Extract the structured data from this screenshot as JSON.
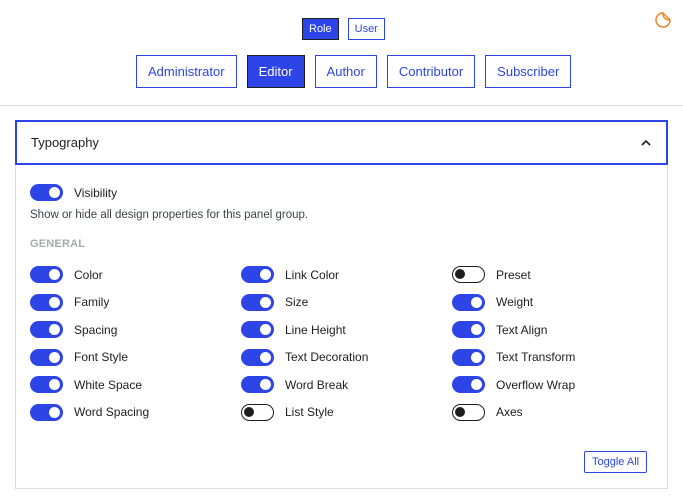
{
  "mode_switch": {
    "options": [
      {
        "label": "Role",
        "active": true
      },
      {
        "label": "User",
        "active": false
      }
    ]
  },
  "top_right_icon": "sticker-icon",
  "role_tabs": [
    {
      "label": "Administrator",
      "active": false
    },
    {
      "label": "Editor",
      "active": true
    },
    {
      "label": "Author",
      "active": false
    },
    {
      "label": "Contributor",
      "active": false
    },
    {
      "label": "Subscriber",
      "active": false
    }
  ],
  "panel": {
    "title": "Typography",
    "expanded": true,
    "visibility": {
      "label": "Visibility",
      "on": true
    },
    "help_text": "Show or hide all design properties for this panel group.",
    "section_label": "GENERAL",
    "columns": [
      [
        {
          "label": "Color",
          "on": true
        },
        {
          "label": "Family",
          "on": true
        },
        {
          "label": "Spacing",
          "on": true
        },
        {
          "label": "Font Style",
          "on": true
        },
        {
          "label": "White Space",
          "on": true
        },
        {
          "label": "Word Spacing",
          "on": true
        }
      ],
      [
        {
          "label": "Link Color",
          "on": true
        },
        {
          "label": "Size",
          "on": true
        },
        {
          "label": "Line Height",
          "on": true
        },
        {
          "label": "Text Decoration",
          "on": true
        },
        {
          "label": "Word Break",
          "on": true
        },
        {
          "label": "List Style",
          "on": false
        }
      ],
      [
        {
          "label": "Preset",
          "on": false
        },
        {
          "label": "Weight",
          "on": true
        },
        {
          "label": "Text Align",
          "on": true
        },
        {
          "label": "Text Transform",
          "on": true
        },
        {
          "label": "Overflow Wrap",
          "on": true
        },
        {
          "label": "Axes",
          "on": false
        }
      ]
    ],
    "toggle_all_label": "Toggle All"
  },
  "colors": {
    "accent": "#2d45e6",
    "sticker_icon": "#f0821e",
    "toggle_off": "#1e1e1e"
  }
}
